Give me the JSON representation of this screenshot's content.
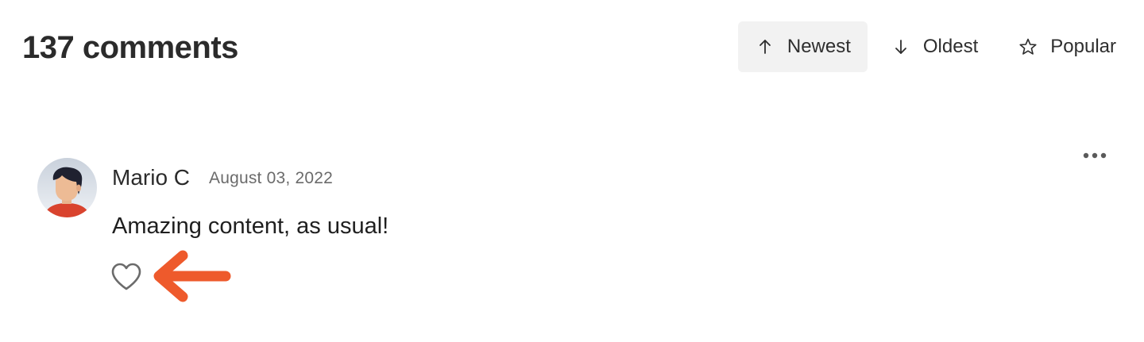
{
  "header": {
    "comment_count": "137 comments"
  },
  "sort_tabs": [
    {
      "label": "Newest",
      "icon": "arrow-up-icon",
      "active": true
    },
    {
      "label": "Oldest",
      "icon": "arrow-down-icon",
      "active": false
    },
    {
      "label": "Popular",
      "icon": "star-icon",
      "active": false
    }
  ],
  "comment": {
    "author": "Mario C",
    "date": "August 03, 2022",
    "body": "Amazing content, as usual!",
    "like_icon": "heart-icon",
    "more_icon": "more-horizontal-icon"
  },
  "annotation": {
    "arrow_color": "#ee5a2c"
  }
}
